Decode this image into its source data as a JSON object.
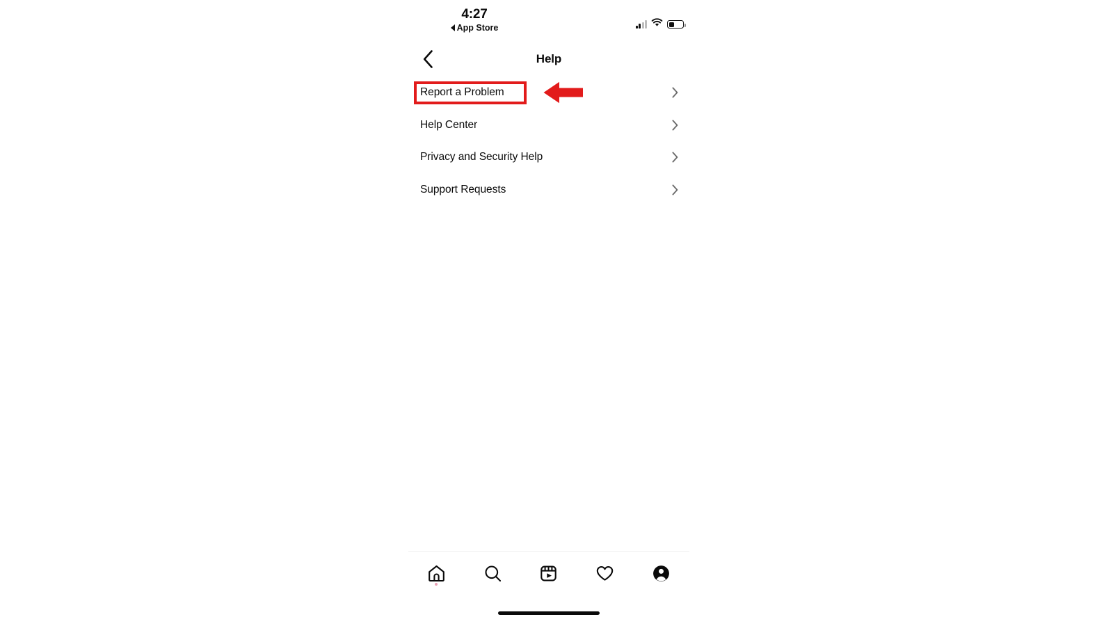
{
  "status_bar": {
    "time": "4:27",
    "back_app_label": "App Store",
    "back_app_icon": "back-triangle-icon",
    "cellular_icon": "cellular-signal-icon",
    "cellular_bars_filled": 2,
    "cellular_bars_total": 4,
    "wifi_icon": "wifi-icon",
    "battery_icon": "battery-low-icon",
    "battery_level_percent": 28
  },
  "header": {
    "title": "Help",
    "back_icon": "chevron-left-icon"
  },
  "menu": {
    "chevron_icon": "chevron-right-icon",
    "items": [
      {
        "label": "Report a Problem"
      },
      {
        "label": "Help Center"
      },
      {
        "label": "Privacy and Security Help"
      },
      {
        "label": "Support Requests"
      }
    ]
  },
  "tab_bar": {
    "tabs": [
      {
        "name": "home",
        "icon": "home-icon",
        "has_dot": true
      },
      {
        "name": "search",
        "icon": "search-icon",
        "has_dot": false
      },
      {
        "name": "reels",
        "icon": "reels-icon",
        "has_dot": false
      },
      {
        "name": "activity",
        "icon": "heart-icon",
        "has_dot": false
      },
      {
        "name": "profile",
        "icon": "profile-avatar-icon",
        "has_dot": false
      }
    ]
  },
  "annotations": {
    "highlight_color": "#e21b1b",
    "highlight_target": "Report a Problem",
    "arrow_icon": "left-pointing-arrow-icon",
    "arrow_color": "#e21b1b"
  },
  "colors": {
    "background": "#ffffff",
    "text_primary": "#0a0a0a",
    "chevron_gray": "#6b6b6b",
    "divider": "#f0f0f0",
    "annotation_red": "#e21b1b",
    "home_dot_pink": "#e8a0b4"
  }
}
